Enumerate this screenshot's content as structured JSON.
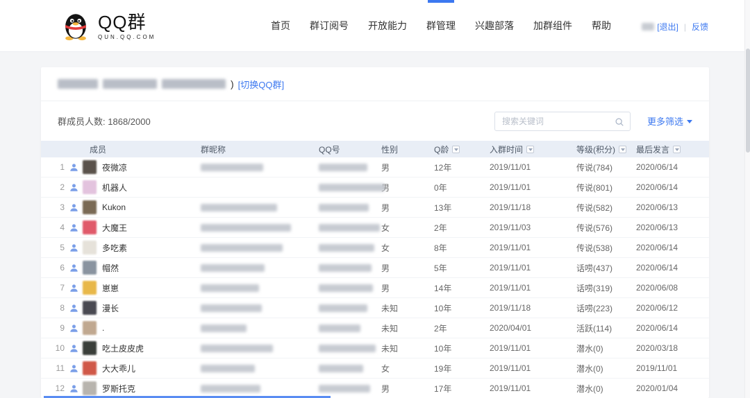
{
  "accent_color": "#3c78f0",
  "header": {
    "logo": {
      "title": "QQ群",
      "subtitle": "QUN.QQ.COM"
    },
    "nav": [
      {
        "key": "home",
        "label": "首页",
        "active": false
      },
      {
        "key": "qun-subscription",
        "label": "群订阅号",
        "active": false
      },
      {
        "key": "open-capability",
        "label": "开放能力",
        "active": false
      },
      {
        "key": "qun-management",
        "label": "群管理",
        "active": true
      },
      {
        "key": "interest-tribe",
        "label": "兴趣部落",
        "active": false
      },
      {
        "key": "join-qun-widget",
        "label": "加群组件",
        "active": false
      },
      {
        "key": "help",
        "label": "帮助",
        "active": false
      }
    ],
    "user": {
      "logout_label": "[退出]",
      "divider": "|",
      "feedback_label": "反馈"
    }
  },
  "group": {
    "name_redacted": true,
    "name_suffix": ")",
    "switch_link": "[切换QQ群]",
    "count_label": "群成员人数:",
    "count_value": "1868/2000"
  },
  "toolbar": {
    "search_placeholder": "搜索关键词",
    "filter_label": "更多筛选"
  },
  "table": {
    "columns": [
      {
        "key": "member",
        "label": "成员",
        "sortable": false
      },
      {
        "key": "group-nickname",
        "label": "群昵称",
        "sortable": false
      },
      {
        "key": "qq-number",
        "label": "QQ号",
        "sortable": false
      },
      {
        "key": "gender",
        "label": "性别",
        "sortable": false
      },
      {
        "key": "q-age",
        "label": "Q龄",
        "sortable": true
      },
      {
        "key": "join-time",
        "label": "入群时间",
        "sortable": true
      },
      {
        "key": "level-points",
        "label": "等级(积分)",
        "sortable": true
      },
      {
        "key": "last-post",
        "label": "最后发言",
        "sortable": true
      }
    ],
    "rows": [
      {
        "num": 1,
        "name": "夜微凉",
        "gender": "男",
        "q_age": "12年",
        "join_date": "2019/11/01",
        "level": "传说(784)",
        "last_post": "2020/06/14",
        "avatar_color": "#5a524b",
        "nickname_w": 90,
        "qq_w": 70
      },
      {
        "num": 2,
        "name": "机器人",
        "gender": "男",
        "q_age": "0年",
        "join_date": "2019/11/01",
        "level": "传说(801)",
        "last_post": "2020/06/14",
        "avatar_color": "#e3c3de",
        "nickname_w": 0,
        "qq_w": 95
      },
      {
        "num": 3,
        "name": "Kukon",
        "gender": "男",
        "q_age": "13年",
        "join_date": "2019/11/18",
        "level": "传说(582)",
        "last_post": "2020/06/13",
        "avatar_color": "#7a6a55",
        "nickname_w": 110,
        "qq_w": 72
      },
      {
        "num": 4,
        "name": "大魔王",
        "gender": "女",
        "q_age": "2年",
        "join_date": "2019/11/03",
        "level": "传说(576)",
        "last_post": "2020/06/13",
        "avatar_color": "#e05a6a",
        "nickname_w": 130,
        "qq_w": 88
      },
      {
        "num": 5,
        "name": "多吃素",
        "gender": "女",
        "q_age": "8年",
        "join_date": "2019/11/01",
        "level": "传说(538)",
        "last_post": "2020/06/14",
        "avatar_color": "#e6e2da",
        "nickname_w": 118,
        "qq_w": 80
      },
      {
        "num": 6,
        "name": "帽然",
        "gender": "男",
        "q_age": "5年",
        "join_date": "2019/11/01",
        "level": "话唠(437)",
        "last_post": "2020/06/14",
        "avatar_color": "#8a94a0",
        "nickname_w": 92,
        "qq_w": 76
      },
      {
        "num": 7,
        "name": "崽崽",
        "gender": "男",
        "q_age": "14年",
        "join_date": "2019/11/01",
        "level": "话唠(319)",
        "last_post": "2020/06/08",
        "avatar_color": "#e8b84a",
        "nickname_w": 84,
        "qq_w": 78
      },
      {
        "num": 8,
        "name": "漫长",
        "gender": "未知",
        "q_age": "10年",
        "join_date": "2019/11/18",
        "level": "话唠(223)",
        "last_post": "2020/06/12",
        "avatar_color": "#4a4a52",
        "nickname_w": 88,
        "qq_w": 70
      },
      {
        "num": 9,
        "name": ".",
        "gender": "未知",
        "q_age": "2年",
        "join_date": "2020/04/01",
        "level": "活跃(114)",
        "last_post": "2020/06/14",
        "avatar_color": "#c0a890",
        "nickname_w": 66,
        "qq_w": 60
      },
      {
        "num": 10,
        "name": "吃土皮皮虎",
        "gender": "未知",
        "q_age": "10年",
        "join_date": "2019/11/01",
        "level": "潜水(0)",
        "last_post": "2020/03/18",
        "avatar_color": "#3a3f3a",
        "nickname_w": 104,
        "qq_w": 82
      },
      {
        "num": 11,
        "name": "大大乖儿",
        "gender": "女",
        "q_age": "19年",
        "join_date": "2019/11/01",
        "level": "潜水(0)",
        "last_post": "2019/11/01",
        "avatar_color": "#d05848",
        "nickname_w": 78,
        "qq_w": 64
      },
      {
        "num": 12,
        "name": "罗斯托克",
        "gender": "男",
        "q_age": "17年",
        "join_date": "2019/11/01",
        "level": "潜水(0)",
        "last_post": "2020/01/04",
        "avatar_color": "#b8b4ae",
        "nickname_w": 86,
        "qq_w": 74
      }
    ]
  }
}
